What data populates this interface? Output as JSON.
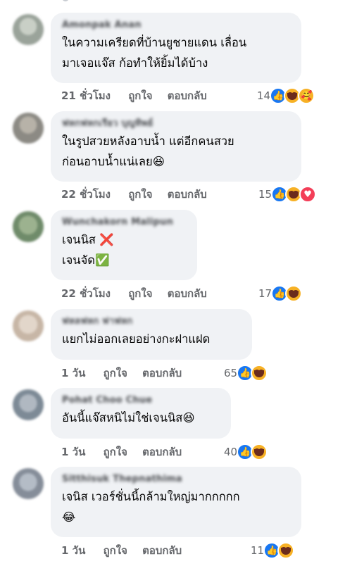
{
  "actions": {
    "like": "ถูกใจ",
    "reply": "ตอบกลับ"
  },
  "colors": {
    "like": "#1877f2",
    "haha": "#f7b125",
    "love": "#f33e58",
    "bubble": "#f0f2f5",
    "meta": "#65676b"
  },
  "comments": [
    {
      "author": "Amonpak Anan",
      "lines": [
        "ในความเครียดที่บ้านยูชายแดน เลื่อน",
        "มาเจอแจ๊ส ก้อทำให้ยิ้มได้บ้าง"
      ],
      "time": "21 ชั่วโมง",
      "count": "14",
      "reactions": [
        "like-icon",
        "haha-icon",
        "care-icon"
      ],
      "avatar_color": "#9aa39a"
    },
    {
      "author": "ฟหกฟหกเรียว บุญทิพย์",
      "lines": [
        "ในรูปสวยหลังอาบน้ำ แต่อีกคนสวย",
        "ก่อนอาบน้ำแน่เลย😆"
      ],
      "time": "22 ชั่วโมง",
      "count": "15",
      "reactions": [
        "like-icon",
        "haha-icon",
        "love-icon"
      ],
      "avatar_color": "#8c8a84"
    },
    {
      "author": "Wunchakorn Malipun",
      "lines": [
        "เจนนิส ❌",
        "เจนจัด✅"
      ],
      "time": "22 ชั่วโมง",
      "count": "17",
      "reactions": [
        "like-icon",
        "haha-icon"
      ],
      "avatar_color": "#6f8b6a"
    },
    {
      "author": "ฟหลฟหก ฟาฟหก",
      "lines": [
        "แยกไม่ออกเลยอย่างกะฝาแฝด"
      ],
      "time": "1 วัน",
      "count": "65",
      "reactions": [
        "like-icon",
        "haha-icon"
      ],
      "avatar_color": "#c7b6a6"
    },
    {
      "author": "Pohat Choo Chue",
      "lines": [
        "อันนี้แจ๊สหนิไม่ใช่เจนนิส😆"
      ],
      "time": "1 วัน",
      "count": "40",
      "reactions": [
        "like-icon",
        "haha-icon"
      ],
      "avatar_color": "#7d8a96"
    },
    {
      "author": "Sitthisuk Thepnathima",
      "lines": [
        "เจนิส เวอร์ชั่นนี้กล้ามใหญ่มากกกกก",
        "😂"
      ],
      "time": "1 วัน",
      "count": "11",
      "reactions": [
        "like-icon",
        "haha-icon"
      ],
      "avatar_color": "#858d99"
    }
  ]
}
